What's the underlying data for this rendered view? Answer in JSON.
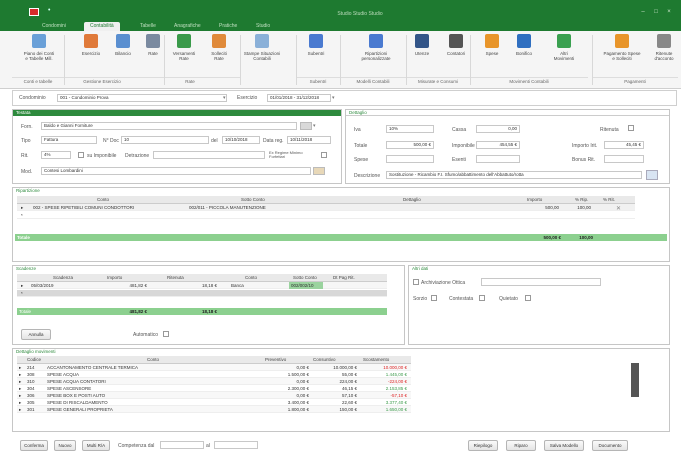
{
  "titlebar": {
    "title": "Studio Studio Studio"
  },
  "tabs": [
    {
      "label": "Condomini"
    },
    {
      "label": "Contabilità"
    },
    {
      "label": "Tabelle"
    },
    {
      "label": "Anagrafiche"
    },
    {
      "label": "Pratiche"
    },
    {
      "label": "Studio"
    }
  ],
  "ribbon": {
    "buttons": [
      {
        "label": "Piano dei Conti\ne Tabelle Mill.",
        "icon": "ledger-icon",
        "color": "#6aa0d8"
      },
      {
        "label": "Esercizio",
        "icon": "calendar-icon",
        "color": "#e07a3a"
      },
      {
        "label": "Bilancio",
        "icon": "balance-icon",
        "color": "#5a8fd0"
      },
      {
        "label": "Rate",
        "icon": "calculator-icon",
        "color": "#7a8aa0"
      },
      {
        "label": "Versamenti\nRate",
        "icon": "coins-icon",
        "color": "#3a9a4a"
      },
      {
        "label": "Solleciti\nRate",
        "icon": "people-icon",
        "color": "#e08a3a"
      },
      {
        "label": "Stampe Situazioni\nContabili",
        "icon": "envelope-icon",
        "color": "#8ab0d8"
      },
      {
        "label": "Subentri",
        "icon": "handover-icon",
        "color": "#4a7ad0"
      },
      {
        "label": "Ripartizioni\npersonalizzate",
        "icon": "split-icon",
        "color": "#4a7ad0"
      },
      {
        "label": "Utenze",
        "icon": "factory-icon",
        "color": "#335588"
      },
      {
        "label": "Contatori",
        "icon": "meter-icon",
        "color": "#555555"
      },
      {
        "label": "Spese",
        "icon": "box-icon",
        "color": "#e8952a"
      },
      {
        "label": "Bonifico",
        "icon": "building-icon",
        "color": "#2f6fc0"
      },
      {
        "label": "Altri\nMovimenti",
        "icon": "transfer-icon",
        "color": "#3aa050"
      },
      {
        "label": "Pagamento Spese\ne Solleciti",
        "icon": "money-icon",
        "color": "#e8952a"
      },
      {
        "label": "Ritenute\nd'acconto",
        "icon": "doc-icon",
        "color": "#888888"
      }
    ],
    "groups": [
      {
        "label": "Conti e tabelle"
      },
      {
        "label": "Gestione Esercizio"
      },
      {
        "label": "Rate"
      },
      {
        "label": "Subentri"
      },
      {
        "label": "Modelli Contabili"
      },
      {
        "label": "Misurate e Consumi"
      },
      {
        "label": "Movimenti Contabili"
      },
      {
        "label": "Pagamenti"
      }
    ]
  },
  "condominio": {
    "label": "Condominio",
    "value": "001 - Condominio Prova",
    "esercizio_label": "Esercizio",
    "esercizio_value": "01/01/2018 - 31/12/2018"
  },
  "testata": {
    "title": "Testata",
    "fornitore_label": "Forn.",
    "fornitore_value": "Baldo e Gianni Forniture",
    "tipo_label": "Tipo",
    "tipo_value": "Fattura",
    "ndoc_label": "N° Doc",
    "ndoc_value": "10",
    "del_label": "del",
    "del_value": "10/10/2018",
    "datareg_label": "Data reg.",
    "datareg_value": "10/11/2018",
    "iva_label": "Rit.",
    "iva_value": "4%",
    "noimpon_label": "su Imponibile",
    "detrazione_label": "Detrazione",
    "regime_label": "Ex Regime Minimo\nForfettari",
    "mod_label": "Mod.",
    "mod_value": "Contesi Lombardini"
  },
  "dettaglio": {
    "title": "Dettaglio",
    "iva_label": "Iva",
    "iva_value": "10%",
    "totale_label": "Totale",
    "totale_value": "500,00 €",
    "spese_label": "Spese",
    "cassa_label": "Cassa",
    "cassa_value": "0,00",
    "imponibile_label": "Imponibile",
    "imponibile_value": "454,55 €",
    "esenti_label": "Esenti",
    "ritenuta_label": "Ritenuta",
    "importo_label": "Importo Irit.",
    "importo_value": "45,45 €",
    "bonus_label": "Bonus Rit.",
    "descrizione_label": "Descrizione",
    "descrizione_value": "Sostituzione - Ricambio F.I. Sfumo/abbattimento dell'Abbattuto/rotta"
  },
  "ripartizione": {
    "title": "Ripartizione",
    "headers": [
      "Conto",
      "Sotto Conto",
      "Dettaglio",
      "Importo",
      "% Rip.",
      "% Rit."
    ],
    "rows": [
      {
        "conto": "002 - SPESE RIPETIBILI COMUNI CONDOTTORI",
        "sotto": "002/011 - PICCOLA MANUTENZIONE",
        "dettaglio": "",
        "importo": "500,00",
        "rip": "100,00",
        "rit": ""
      }
    ],
    "totals_label": "Totale",
    "total_importo": "500,00 €",
    "total_rip": "100,00"
  },
  "scadenze": {
    "title": "Scadenze",
    "headers": [
      "Scadenza",
      "Importo",
      "Ritenuta",
      "Conto",
      "Sotto Conto",
      "Dt Pag Rit."
    ],
    "rows": [
      {
        "scadenza": "05/03/2019",
        "importo": "481,82 €",
        "ritenuta": "18,18 €",
        "conto": "Banca",
        "sotto": "002/002/10",
        "dt": ""
      }
    ],
    "totals_label": "Totale",
    "total_importo": "481,82 €",
    "total_ritenuta": "18,18 €",
    "annulla_label": "Annulla",
    "automatico_label": "Automatico"
  },
  "altri": {
    "title": "Altri dati",
    "archiviazione_label": "Archiviazione Ottica",
    "sorzio_label": "Sorzio",
    "contestata_label": "Contestata",
    "quiete_label": "Quietato"
  },
  "dettaglio_movimenti": {
    "title": "Dettaglio movimenti",
    "headers": [
      "Codice",
      "Conto",
      "Preventivo",
      "Consuntivo",
      "Scostamento"
    ],
    "rows": [
      {
        "codice": "214",
        "conto": "ACCANTONAMENTO CENTRALE TERMICA",
        "prev": "0,00 €",
        "cons": "10.000,00 €",
        "scost": "10.000,00 €",
        "red": true
      },
      {
        "codice": "308",
        "conto": "SPESE ACQUA",
        "prev": "1.500,00 €",
        "cons": "55,00 €",
        "scost": "1.445,00 €",
        "red": false
      },
      {
        "codice": "310",
        "conto": "SPESE ACQUA CONTATORI",
        "prev": "0,00 €",
        "cons": "224,00 €",
        "scost": "-224,00 €",
        "red": true
      },
      {
        "codice": "304",
        "conto": "SPESE ASCENSORE",
        "prev": "2.300,00 €",
        "cons": "46,15 €",
        "scost": "2.153,85 €",
        "red": false
      },
      {
        "codice": "306",
        "conto": "SPESE BOX E POSTI AUTO",
        "prev": "0,00 €",
        "cons": "57,10 €",
        "scost": "-57,10 €",
        "red": true
      },
      {
        "codice": "305",
        "conto": "SPESE DI RISCALDAMENTO",
        "prev": "3.400,00 €",
        "cons": "22,60 €",
        "scost": "3.377,40 €",
        "red": false
      },
      {
        "codice": "301",
        "conto": "SPESE GENERALI PROPRIETA",
        "prev": "1.800,00 €",
        "cons": "150,00 €",
        "scost": "1.650,00 €",
        "red": false
      }
    ]
  },
  "footer": {
    "conferma": "Conferma",
    "nuovo": "Nuovo",
    "multi": "Multi R/A",
    "competenza_label": "Competenza dal",
    "al_label": "al",
    "riepilogo": "Riepilogo",
    "rigeneri": "Riparo",
    "salva": "Salva Modello",
    "documento": "Documento"
  }
}
